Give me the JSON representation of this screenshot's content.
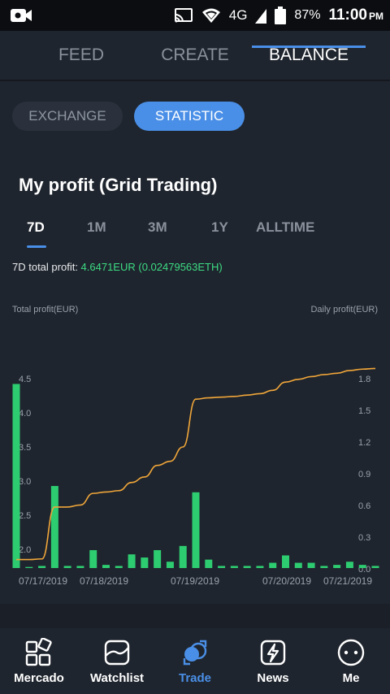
{
  "status_bar": {
    "network": "4G",
    "battery": "87%",
    "time": "11:00",
    "ampm": "PM"
  },
  "top_tabs": [
    {
      "label": "FEED",
      "active": false
    },
    {
      "label": "CREATE",
      "active": false
    },
    {
      "label": "BALANCE",
      "active": true
    }
  ],
  "segment": {
    "exchange": "EXCHANGE",
    "statistic": "STATISTIC",
    "selected": "STATISTIC"
  },
  "section_title": "My profit (Grid Trading)",
  "range_tabs": [
    "7D",
    "1M",
    "3M",
    "1Y",
    "ALLTIME"
  ],
  "range_selected": "7D",
  "total_profit": {
    "label": "7D total profit: ",
    "value": "4.6471EUR (0.02479563ETH)"
  },
  "chart_data": {
    "type": "bar+line",
    "left_axis_title": "Total profit(EUR)",
    "right_axis_title": "Daily profit(EUR)",
    "left_ticks": [
      "4.5",
      "4.0",
      "3.5",
      "3.0",
      "2.5",
      "2.0"
    ],
    "right_ticks": [
      "1.8",
      "1.5",
      "1.2",
      "0.9",
      "0.6",
      "0.3",
      "0.0"
    ],
    "x_ticks": [
      "07/17/2019",
      "07/18/2019",
      "07/19/2019",
      "07/20/2019",
      "07/21/2019"
    ],
    "colors": {
      "bars": "#2ecc71",
      "line": "#f0a63a",
      "ticks": "#9aa1ab"
    },
    "daily_profit_eur": [
      1.75,
      0.01,
      0.02,
      0.78,
      0.02,
      0.02,
      0.17,
      0.03,
      0.02,
      0.13,
      0.1,
      0.17,
      0.06,
      0.21,
      0.72,
      0.08,
      0.02,
      0.02,
      0.02,
      0.02,
      0.05,
      0.12,
      0.05,
      0.05,
      0.02,
      0.03,
      0.06,
      0.03,
      0.02
    ],
    "cumulative_profit_eur": [
      1.85,
      1.85,
      1.86,
      2.62,
      2.62,
      2.65,
      2.82,
      2.84,
      2.86,
      2.98,
      3.06,
      3.23,
      3.29,
      3.5,
      4.2,
      4.22,
      4.23,
      4.24,
      4.26,
      4.28,
      4.33,
      4.45,
      4.49,
      4.53,
      4.56,
      4.58,
      4.62,
      4.64,
      4.65
    ]
  },
  "bottom_nav": [
    {
      "label": "Mercado",
      "icon": "grid-icon",
      "active": false
    },
    {
      "label": "Watchlist",
      "icon": "chart-card-icon",
      "active": false
    },
    {
      "label": "Trade",
      "icon": "trade-icon",
      "active": true
    },
    {
      "label": "News",
      "icon": "lightning-icon",
      "active": false
    },
    {
      "label": "Me",
      "icon": "smiley-icon",
      "active": false
    }
  ]
}
